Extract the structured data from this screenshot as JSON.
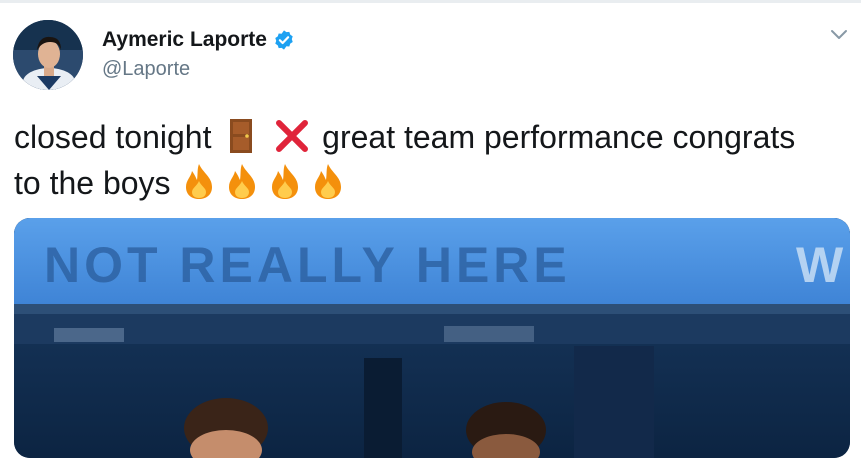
{
  "tweet": {
    "author_name": "Aymeric Laporte",
    "author_handle": "@Laporte",
    "text_part1": "closed tonight",
    "text_part2": "great team performance congrats",
    "text_part3": "to the boys",
    "emojis": [
      "door-emoji",
      "cross-mark-emoji",
      "fire-emoji",
      "fire-emoji",
      "fire-emoji",
      "fire-emoji"
    ],
    "media": {
      "banner_text": "NOT REALLY HERE",
      "banner_edge_letter": "W"
    }
  },
  "colors": {
    "text": "#14171a",
    "handle": "#657786",
    "verified": "#1da1f2",
    "banner": "#4a90e2",
    "stands": "#0f2b4c"
  },
  "icons": [
    "verified-badge-icon",
    "chevron-down-icon"
  ]
}
